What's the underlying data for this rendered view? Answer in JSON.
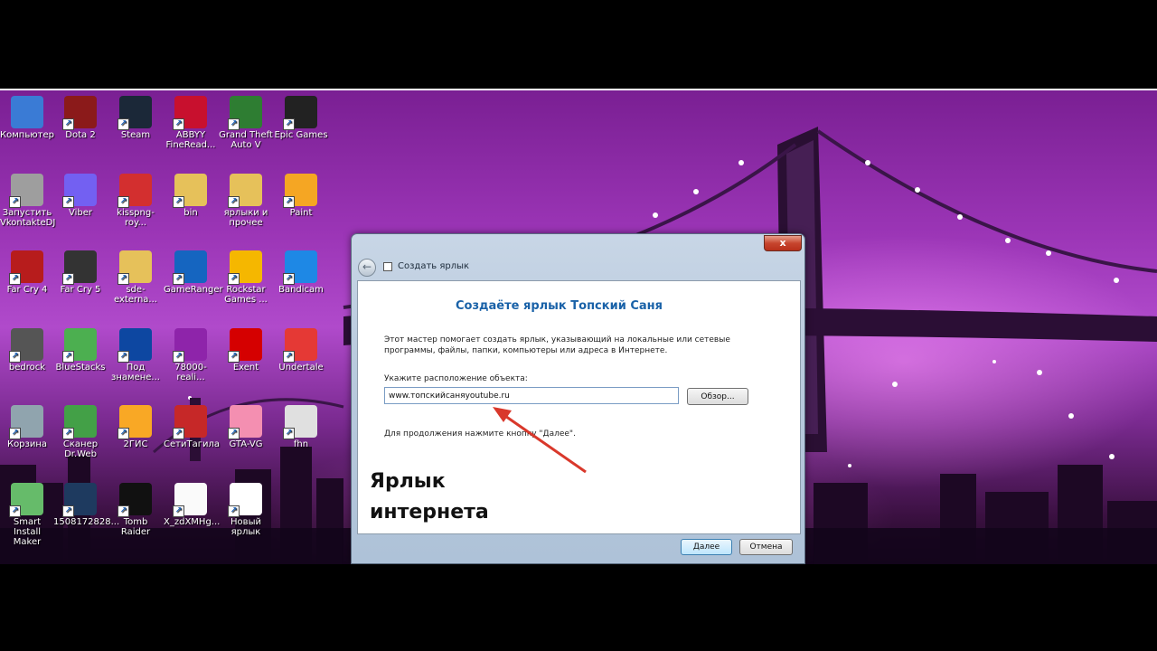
{
  "desktop_icons": [
    {
      "label": "Компьютер",
      "icon": "computer-icon",
      "color": "#3a7bd5"
    },
    {
      "label": "Dota 2",
      "icon": "dota-icon",
      "color": "#8b1a1a"
    },
    {
      "label": "Steam",
      "icon": "steam-icon",
      "color": "#1b2838"
    },
    {
      "label": "ABBYY FineRead...",
      "icon": "abbyy-icon",
      "color": "#c8102e"
    },
    {
      "label": "Grand Theft Auto V",
      "icon": "gta-icon",
      "color": "#2e7d32"
    },
    {
      "label": "Epic Games",
      "icon": "epic-icon",
      "color": "#222222"
    },
    {
      "label": "Запустить VkontakteDJ",
      "icon": "vkdj-icon",
      "color": "#9e9e9e"
    },
    {
      "label": "Viber",
      "icon": "viber-icon",
      "color": "#7360f2"
    },
    {
      "label": "kisspng-roy...",
      "icon": "image-file-icon",
      "color": "#d32f2f"
    },
    {
      "label": "bin",
      "icon": "folder-icon",
      "color": "#e6c15a"
    },
    {
      "label": "ярлыки и прочее",
      "icon": "folder-icon",
      "color": "#e6c15a"
    },
    {
      "label": "Paint",
      "icon": "paint-icon",
      "color": "#f5a623"
    },
    {
      "label": "Far Cry 4",
      "icon": "farcry4-icon",
      "color": "#b71c1c"
    },
    {
      "label": "Far Cry 5",
      "icon": "farcry5-icon",
      "color": "#333333"
    },
    {
      "label": "sde-externa...",
      "icon": "folder-icon",
      "color": "#e6c15a"
    },
    {
      "label": "GameRanger",
      "icon": "gameranger-icon",
      "color": "#1565c0"
    },
    {
      "label": "Rockstar Games ...",
      "icon": "rockstar-icon",
      "color": "#f5b700"
    },
    {
      "label": "Bandicam",
      "icon": "bandicam-icon",
      "color": "#1e88e5"
    },
    {
      "label": "bedrock",
      "icon": "bedrock-icon",
      "color": "#555555"
    },
    {
      "label": "BlueStacks",
      "icon": "bluestacks-icon",
      "color": "#4caf50"
    },
    {
      "label": "Под знамене...",
      "icon": "game-icon",
      "color": "#0d47a1"
    },
    {
      "label": "78000-reali...",
      "icon": "winrar-icon",
      "color": "#8e24aa"
    },
    {
      "label": "Exent",
      "icon": "exent-icon",
      "color": "#d50000"
    },
    {
      "label": "Undertale",
      "icon": "undertale-icon",
      "color": "#e53935"
    },
    {
      "label": "Корзина",
      "icon": "recycle-bin-icon",
      "color": "#90a4ae"
    },
    {
      "label": "Сканер Dr.Web",
      "icon": "drweb-icon",
      "color": "#43a047"
    },
    {
      "label": "2ГИС",
      "icon": "2gis-icon",
      "color": "#f9a825"
    },
    {
      "label": "СетиТагила",
      "icon": "seti-icon",
      "color": "#c62828"
    },
    {
      "label": "GTA-VG",
      "icon": "image-file-icon",
      "color": "#f48fb1"
    },
    {
      "label": "fhn",
      "icon": "file-icon",
      "color": "#e0e0e0"
    },
    {
      "label": "Smart Install Maker",
      "icon": "install-icon",
      "color": "#66bb6a"
    },
    {
      "label": "1508172828...",
      "icon": "image-file-icon",
      "color": "#1e3a5f"
    },
    {
      "label": "Tomb Raider",
      "icon": "tombraider-icon",
      "color": "#111111"
    },
    {
      "label": "X_zdXMHg...",
      "icon": "image-file-icon",
      "color": "#fafafa"
    },
    {
      "label": "Новый ярлык",
      "icon": "shortcut-file-icon",
      "color": "#ffffff"
    }
  ],
  "dialog": {
    "close_label": "x",
    "back_label": "←",
    "title": "Создать ярлык",
    "heading": "Создаёте ярлык Топский Саня",
    "description": "Этот мастер помогает создать ярлык, указывающий на локальные или сетевые программы, файлы, папки, компьютеры или адреса в Интернете.",
    "location_label": "Укажите расположение объекта:",
    "location_value": "www.топскийсаняyoutube.ru",
    "browse_label": "Обзор...",
    "next_hint": "Для продолжения нажмите кнопку \"Далее\".",
    "overlay_line1": "Ярлык",
    "overlay_line2": "интернета",
    "next_label": "Далее",
    "cancel_label": "Отмена"
  },
  "colors": {
    "heading": "#1a62a8",
    "annotation_arrow": "#d9382b"
  }
}
